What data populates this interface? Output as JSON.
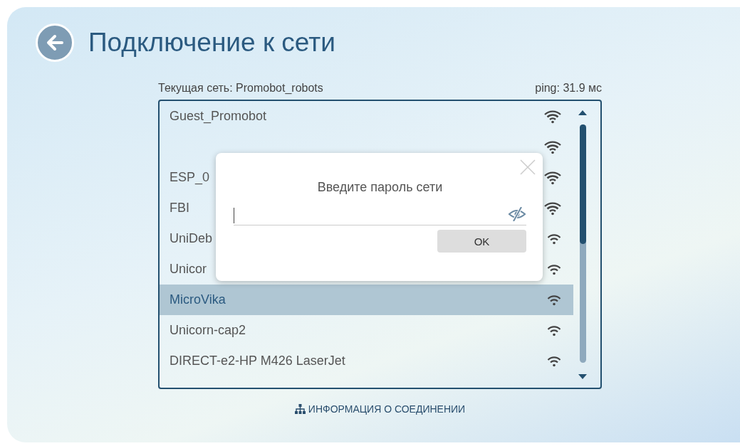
{
  "screen": {
    "title": "Подключение к сети",
    "current_network": "Текущая сеть: Promobot_robots",
    "ping": "ping: 31.9 мс"
  },
  "networks": [
    {
      "name": "Guest_Promobot",
      "selected": false,
      "kind": "strong"
    },
    {
      "selected": false,
      "kind": "strong"
    },
    {
      "name": "ESP_0",
      "selected": false,
      "kind": "strong"
    },
    {
      "name": "FBI",
      "selected": false,
      "kind": "strong"
    },
    {
      "name": "UniDeb",
      "selected": false,
      "kind": "medium"
    },
    {
      "name": "Unicor",
      "selected": false,
      "kind": "medium"
    },
    {
      "name": "MicroVika",
      "selected": true,
      "kind": "medium"
    },
    {
      "name": "Unicorn-cap2",
      "selected": false,
      "kind": "medium"
    },
    {
      "name": "DIRECT-e2-HP M426 LaserJet",
      "selected": false,
      "kind": "medium"
    }
  ],
  "dialog": {
    "title": "Введите пароль сети",
    "password_visible": false,
    "ok_button": "OK"
  },
  "footer_link": "ИНФОРМАЦИЯ О СОЕДИНЕНИИ"
}
